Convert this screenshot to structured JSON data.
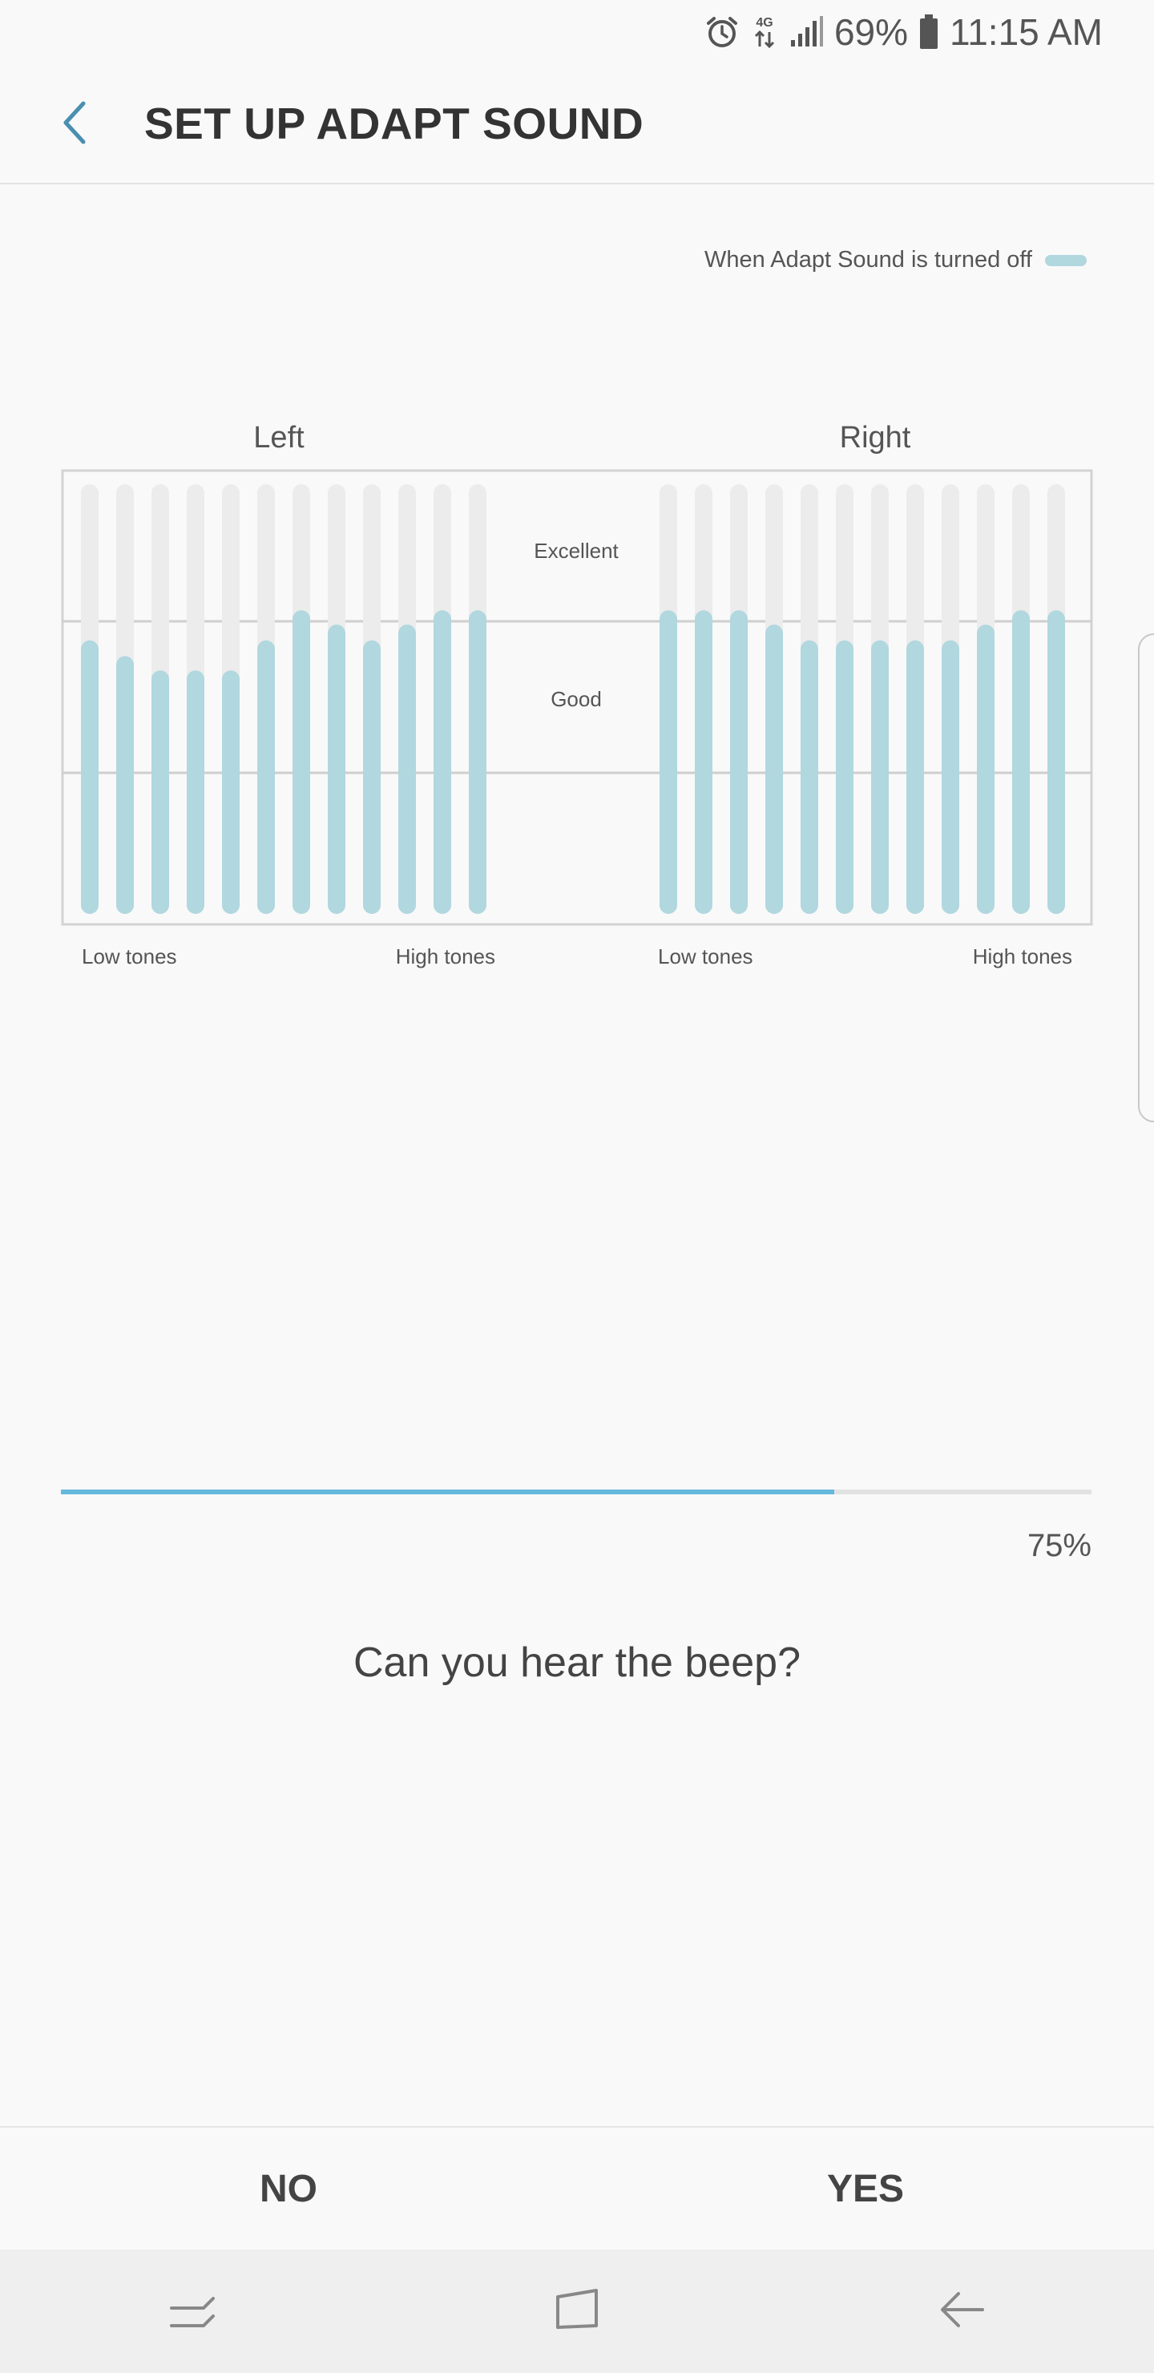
{
  "status_bar": {
    "network_type": "4G",
    "battery": "69%",
    "time": "11:15 AM",
    "icons": [
      "alarm-icon",
      "network-data-icon",
      "signal-icon",
      "battery-icon"
    ]
  },
  "header": {
    "title": "SET UP ADAPT SOUND",
    "back_icon": "chevron-left-icon"
  },
  "legend": {
    "label": "When Adapt Sound is turned off",
    "color": "#b1d7df"
  },
  "chart_data": {
    "type": "bar",
    "level_labels": [
      "Excellent",
      "Good"
    ],
    "ylim": [
      0,
      3
    ],
    "colors": {
      "bar": "#b1d7df",
      "track": "#ececec",
      "frame": "#d3d3d3",
      "divider": "#cfcfcf"
    },
    "panels": [
      {
        "title": "Left",
        "x_start_label": "Low tones",
        "x_end_label": "High tones",
        "values": [
          1.91,
          1.8,
          1.7,
          1.7,
          1.7,
          1.91,
          2.12,
          2.02,
          1.91,
          2.02,
          2.12,
          2.12
        ]
      },
      {
        "title": "Right",
        "x_start_label": "Low tones",
        "x_end_label": "High tones",
        "values": [
          2.12,
          2.12,
          2.12,
          2.02,
          1.91,
          1.91,
          1.91,
          1.91,
          1.91,
          2.02,
          2.12,
          2.12
        ]
      }
    ]
  },
  "progress": {
    "value": 0.75,
    "label": "75%",
    "color": "#66b9dd"
  },
  "question": "Can you hear the beep?",
  "actions": {
    "no": "NO",
    "yes": "YES"
  },
  "nav_bar": {
    "recents_icon": "recent-apps-icon",
    "home_icon": "home-icon",
    "back_icon": "back-arrow-icon"
  }
}
